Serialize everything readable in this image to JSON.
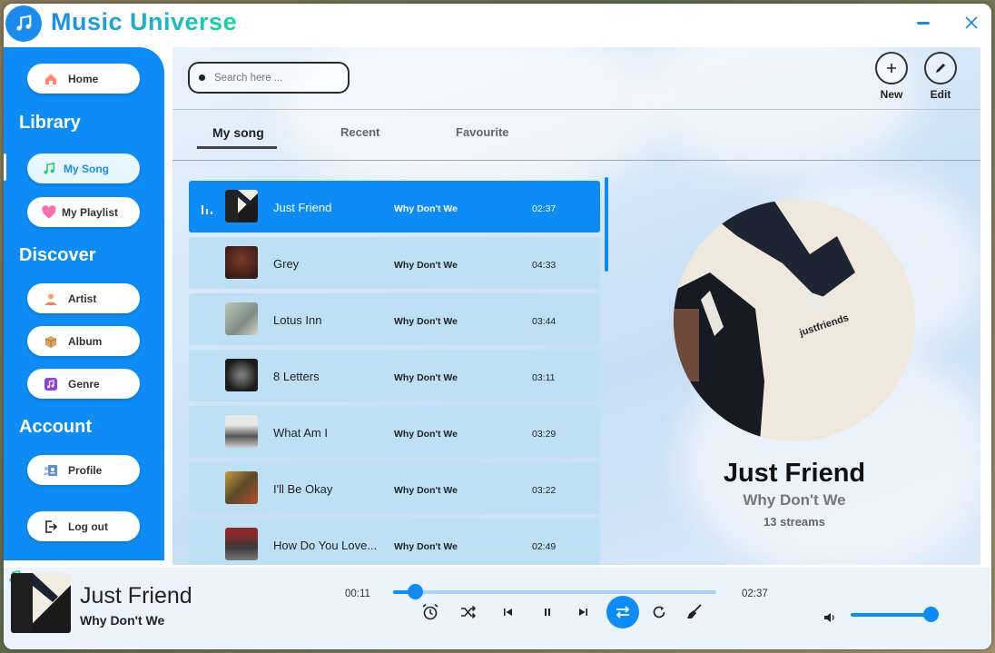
{
  "app": {
    "title": "Music Universe"
  },
  "sidebar": {
    "home_label": "Home",
    "library_title": "Library",
    "my_song_label": "My Song",
    "my_playlist_label": "My Playlist",
    "discover_title": "Discover",
    "artist_label": "Artist",
    "album_label": "Album",
    "genre_label": "Genre",
    "account_title": "Account",
    "profile_label": "Profile",
    "logout_label": "Log out"
  },
  "search": {
    "placeholder": "Search here ..."
  },
  "actions": {
    "new_label": "New",
    "edit_label": "Edit"
  },
  "tabs": {
    "my_song": "My song",
    "recent": "Recent",
    "favourite": "Favourite"
  },
  "songs": [
    {
      "title": "Just Friend",
      "artist": "Why Don't We",
      "duration": "02:37"
    },
    {
      "title": "Grey",
      "artist": "Why Don't We",
      "duration": "04:33"
    },
    {
      "title": "Lotus Inn",
      "artist": "Why Don't We",
      "duration": "03:44"
    },
    {
      "title": "8 Letters",
      "artist": "Why Don't We",
      "duration": "03:11"
    },
    {
      "title": "What Am I",
      "artist": "Why Don't We",
      "duration": "03:29"
    },
    {
      "title": "I'll Be Okay",
      "artist": "Why Don't We",
      "duration": "03:22"
    },
    {
      "title": "How Do You Love...",
      "artist": "Why Don't We",
      "duration": "02:49"
    }
  ],
  "now_playing": {
    "title": "Just Friend",
    "artist": "Why Don't We",
    "streams": "13 streams",
    "album_text": "justfriends"
  },
  "player": {
    "title": "Just Friend",
    "artist": "Why Don't We",
    "elapsed": "00:11",
    "total": "02:37",
    "progress": 0.07,
    "volume": 1.0
  },
  "colors": {
    "accent": "#0d8cf7",
    "row": "#bee0f5",
    "title_gradient_end": "#18d6a0"
  }
}
